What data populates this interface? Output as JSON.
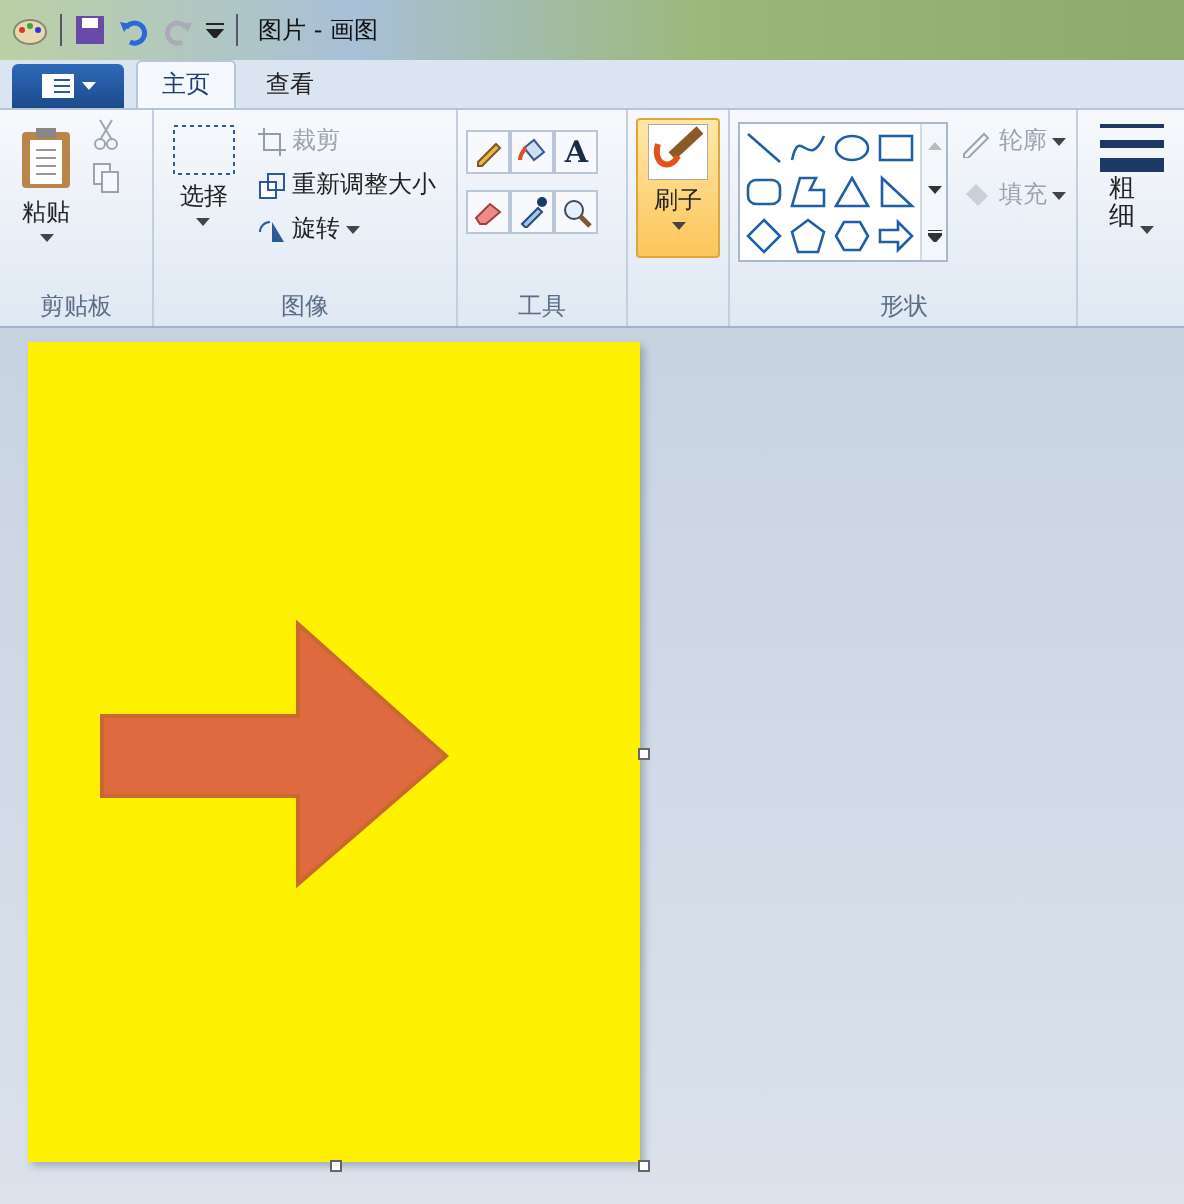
{
  "window": {
    "title": "图片 - 画图"
  },
  "tabs": [
    {
      "label": "主页",
      "selected": true
    },
    {
      "label": "查看",
      "selected": false
    }
  ],
  "clipboard": {
    "label": "剪贴板",
    "paste": "粘贴",
    "cut_disabled": true,
    "copy_disabled": true
  },
  "image": {
    "label": "图像",
    "select": "选择",
    "actions": [
      {
        "kind": "crop",
        "label": "裁剪",
        "disabled": true
      },
      {
        "kind": "resize",
        "label": "重新调整大小",
        "disabled": false
      },
      {
        "kind": "rotate",
        "label": "旋转",
        "disabled": false
      }
    ]
  },
  "tools": {
    "label": "工具",
    "items": [
      {
        "kind": "pencil"
      },
      {
        "kind": "fill"
      },
      {
        "kind": "text",
        "glyph": "A"
      },
      {
        "kind": "eraser"
      },
      {
        "kind": "picker"
      },
      {
        "kind": "magnifier"
      }
    ]
  },
  "brushes": {
    "label": "刷子",
    "selected": true
  },
  "shapes": {
    "label": "形状",
    "items": [
      {
        "kind": "line"
      },
      {
        "kind": "curve"
      },
      {
        "kind": "oval"
      },
      {
        "kind": "rect"
      },
      {
        "kind": "roundrect"
      },
      {
        "kind": "polygon"
      },
      {
        "kind": "triangle"
      },
      {
        "kind": "righttri"
      },
      {
        "kind": "diamond"
      },
      {
        "kind": "pentagon"
      },
      {
        "kind": "hexagon"
      },
      {
        "kind": "arrow"
      }
    ],
    "options": [
      {
        "kind": "outline",
        "label": "轮廓",
        "disabled": true
      },
      {
        "kind": "fill",
        "label": "填充",
        "disabled": true
      }
    ]
  },
  "size": {
    "label": "粗细"
  }
}
